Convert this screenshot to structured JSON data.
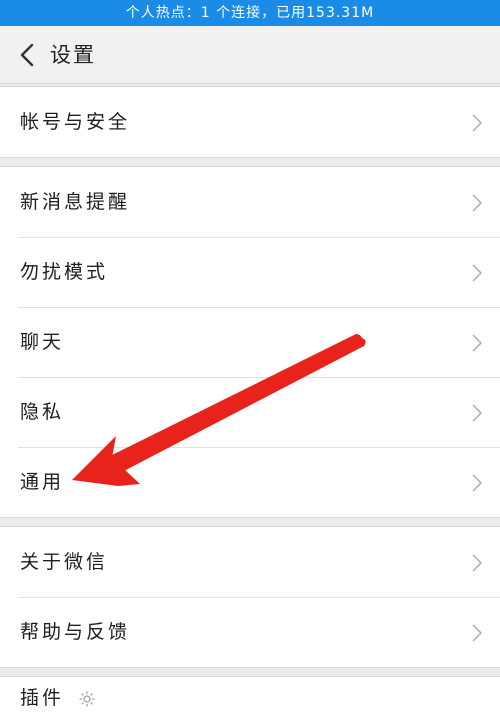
{
  "status_bar": {
    "text": "个人热点：1 个连接，已用153.31M"
  },
  "header": {
    "back_icon": "chevron-left-icon",
    "title": "设置"
  },
  "groups": [
    {
      "items": [
        {
          "label": "帐号与安全"
        }
      ]
    },
    {
      "items": [
        {
          "label": "新消息提醒"
        },
        {
          "label": "勿扰模式"
        },
        {
          "label": "聊天"
        },
        {
          "label": "隐私"
        },
        {
          "label": "通用"
        }
      ]
    },
    {
      "items": [
        {
          "label": "关于微信"
        },
        {
          "label": "帮助与反馈"
        }
      ]
    },
    {
      "items": [
        {
          "label": "插件"
        }
      ]
    }
  ],
  "annotation": {
    "type": "red-arrow",
    "points_to": "通用",
    "color": "#e8231c"
  },
  "colors": {
    "status_bar": "#1a8ce8",
    "background": "#ececec",
    "row_background": "#ffffff",
    "chevron": "#b3b3b3"
  }
}
